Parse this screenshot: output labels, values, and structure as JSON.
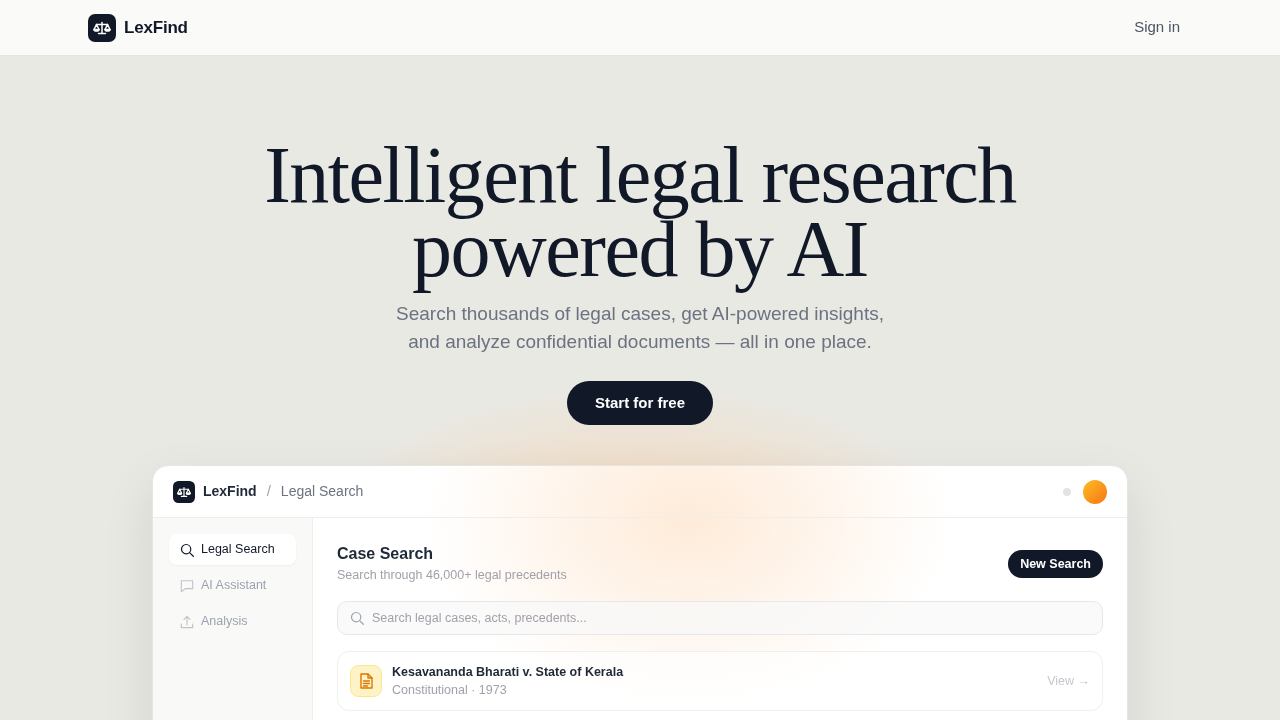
{
  "header": {
    "brand": "LexFind",
    "sign_in": "Sign in"
  },
  "hero": {
    "title": "Intelligent legal research powered by AI",
    "subtitle": "Search thousands of legal cases, get AI-powered insights, and analyze confidential documents — all in one place.",
    "cta": "Start for free"
  },
  "preview": {
    "brand": "LexFind",
    "separator": "/",
    "breadcrumb": "Legal Search",
    "sidebar": {
      "items": [
        {
          "label": "Legal Search",
          "selected": true
        },
        {
          "label": "AI Assistant",
          "selected": false
        },
        {
          "label": "Analysis",
          "selected": false
        }
      ]
    },
    "main": {
      "title": "Case Search",
      "subtitle": "Search through 46,000+ legal precedents",
      "new_button": "New Search",
      "search": {
        "placeholder": "Search legal cases, acts, precedents..."
      },
      "results": [
        {
          "title": "Kesavananda Bharati v. State of Kerala",
          "meta": "Constitutional · 1973",
          "action": "View →"
        }
      ]
    }
  }
}
